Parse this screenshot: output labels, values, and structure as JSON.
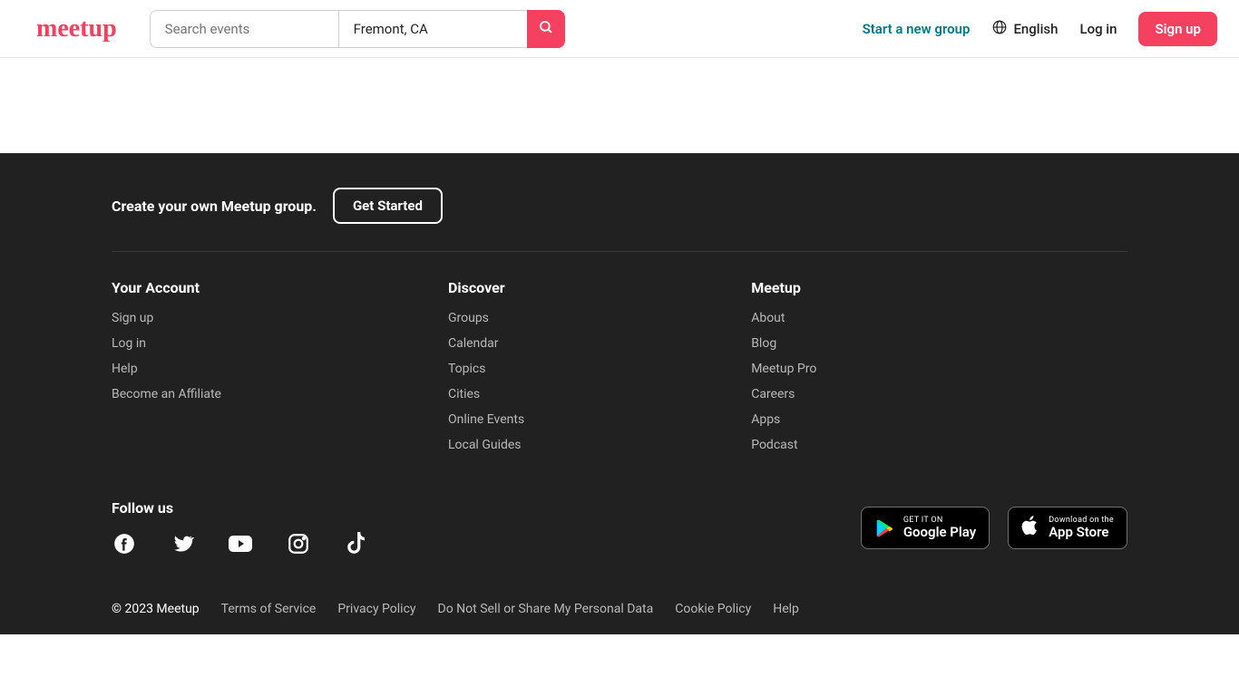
{
  "header": {
    "logo_text": "meetup",
    "search_placeholder": "Search events",
    "location_value": "Fremont, CA",
    "start_group": "Start a new group",
    "language_label": "English",
    "login_label": "Log in",
    "signup_label": "Sign up"
  },
  "footer": {
    "cta_text": "Create your own Meetup group.",
    "cta_button": "Get Started",
    "cols": {
      "account": {
        "heading": "Your Account",
        "links": [
          "Sign up",
          "Log in",
          "Help",
          "Become an Affiliate"
        ]
      },
      "discover": {
        "heading": "Discover",
        "links": [
          "Groups",
          "Calendar",
          "Topics",
          "Cities",
          "Online Events",
          "Local Guides"
        ]
      },
      "meetup": {
        "heading": "Meetup",
        "links": [
          "About",
          "Blog",
          "Meetup Pro",
          "Careers",
          "Apps",
          "Podcast"
        ]
      }
    },
    "follow_heading": "Follow us",
    "google_play_top": "GET IT ON",
    "google_play_bottom": "Google Play",
    "app_store_top": "Download on the",
    "app_store_bottom": "App Store",
    "copyright": "© 2023 Meetup",
    "legal": [
      "Terms of Service",
      "Privacy Policy",
      "Do Not Sell or Share My Personal Data",
      "Cookie Policy",
      "Help"
    ]
  }
}
